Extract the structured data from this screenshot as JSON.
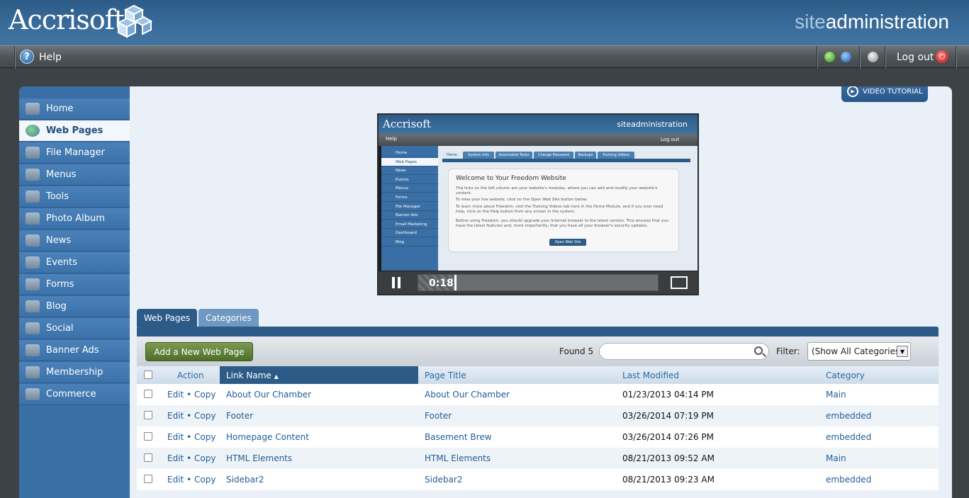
{
  "header": {
    "logo": "Accrisoft",
    "site_prefix": "site",
    "site_suffix": "administration"
  },
  "topbar": {
    "help_label": "Help",
    "logout_label": "Log out"
  },
  "colors": {
    "brand_blue": "#2d5b87",
    "add_button_green": "#5a7d35",
    "link_blue": "#225e98"
  },
  "sidebar": {
    "items": [
      {
        "label": "Home",
        "icon": "home-icon"
      },
      {
        "label": "Web Pages",
        "icon": "globe-icon",
        "active": true
      },
      {
        "label": "File Manager",
        "icon": "folder-icon"
      },
      {
        "label": "Menus",
        "icon": "menu-icon"
      },
      {
        "label": "Tools",
        "icon": "wrench-icon"
      },
      {
        "label": "Photo Album",
        "icon": "camera-icon"
      },
      {
        "label": "News",
        "icon": "newspaper-icon"
      },
      {
        "label": "Events",
        "icon": "calendar-icon"
      },
      {
        "label": "Forms",
        "icon": "form-icon"
      },
      {
        "label": "Blog",
        "icon": "blog-icon"
      },
      {
        "label": "Social",
        "icon": "social-icon"
      },
      {
        "label": "Banner Ads",
        "icon": "banner-icon"
      },
      {
        "label": "Membership",
        "icon": "membership-icon"
      },
      {
        "label": "Commerce",
        "icon": "commerce-icon"
      }
    ]
  },
  "video": {
    "button_label": "VIDEO TUTORIAL",
    "time": "0:18",
    "progress_fraction": 0.15,
    "screen": {
      "logo": "Accrisoft",
      "site": "siteadministration",
      "help": "Help",
      "logout": "Log out",
      "nav": [
        "Home",
        "Web Pages",
        "News",
        "Events",
        "Menus",
        "Forms",
        "File Manager",
        "Banner Ads",
        "Email Marketing",
        "Dashboard",
        "Blog"
      ],
      "tabs": [
        "Home",
        "System Info",
        "Automated Tasks",
        "Change Password",
        "Backups",
        "Training Videos"
      ],
      "card_title": "Welcome to Your Freedom Website",
      "paragraphs": [
        "The links on the left column are your website's modules, where you can add and modify your website's content.",
        "To view your live website, click on the Open Web Site button below.",
        "To learn more about Freedom, visit the Training Videos tab here in the Home Module, and if you ever need help, click on the Help button from any screen in the system.",
        "Before using Freedom, you should upgrade your Internet browser to the latest version. This ensures that you have the latest features and, more importantly, that you have all your browser's security updates."
      ],
      "open_button": "Open Web Site"
    }
  },
  "tabs": [
    {
      "label": "Web Pages",
      "active": true
    },
    {
      "label": "Categories",
      "active": false
    }
  ],
  "toolbar": {
    "add_label": "Add a New Web Page",
    "found_label": "Found 5",
    "search_value": "",
    "filter_label": "Filter:",
    "filter_value": "(Show All Categories)"
  },
  "table": {
    "columns": {
      "action": "Action",
      "link_name": "Link Name",
      "page_title": "Page Title",
      "last_modified": "Last Modified",
      "category": "Category"
    },
    "edit_label": "Edit",
    "dot": "•",
    "copy_label": "Copy",
    "rows": [
      {
        "link": "About Our Chamber",
        "title": "About Our Chamber",
        "modified": "01/23/2013 04:14 PM",
        "category": "Main"
      },
      {
        "link": "Footer",
        "title": "Footer",
        "modified": "03/26/2014 07:19 PM",
        "category": "embedded"
      },
      {
        "link": "Homepage Content",
        "title": "Basement Brew",
        "modified": "03/26/2014 07:26 PM",
        "category": "embedded"
      },
      {
        "link": "HTML Elements",
        "title": "HTML Elements",
        "modified": "08/21/2013 09:52 AM",
        "category": "Main"
      },
      {
        "link": "Sidebar2",
        "title": "Sidebar2",
        "modified": "08/21/2013 09:23 AM",
        "category": "embedded"
      }
    ]
  }
}
